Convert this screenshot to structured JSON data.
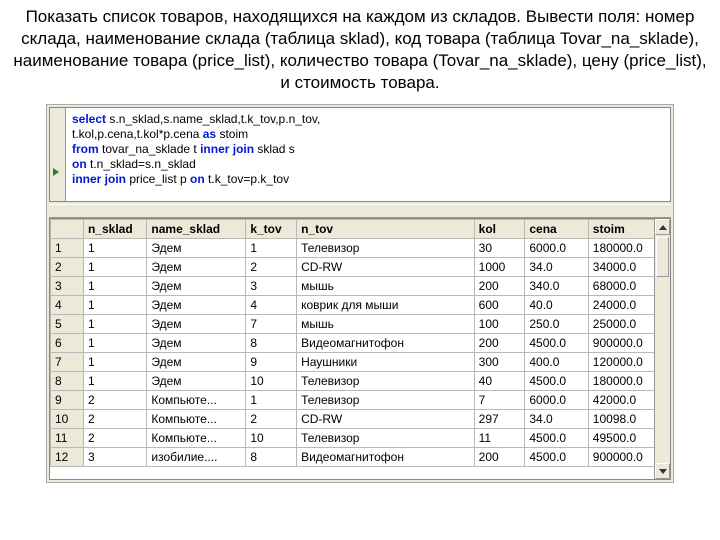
{
  "task": "Показать список товаров, находящихся на каждом из складов. Вывести поля: номер склада, наименование склада (таблица sklad), код товара (таблица Tovar_na_sklade), наименование товара (price_list), количество товара (Tovar_na_sklade), цену (price_list), и стоимость товара.",
  "sql": {
    "l1a": "select",
    "l1b": " s.n_sklad,s.name_sklad,t.k_tov,p.n_tov,",
    "l2a": "t.kol,p.cena,t.kol*p.cena ",
    "l2b": "as",
    "l2c": " stoim",
    "l3a": "from",
    "l3b": " tovar_na_sklade t ",
    "l3c": "inner join",
    "l3d": " sklad s",
    "l4a": "on",
    "l4b": " t.n_sklad=s.n_sklad",
    "l5a": "inner join",
    "l5b": " price_list p ",
    "l5c": "on",
    "l5d": " t.k_tov=p.k_tov"
  },
  "columns": {
    "n_sklad": "n_sklad",
    "name_sklad": "name_sklad",
    "k_tov": "k_tov",
    "n_tov": "n_tov",
    "kol": "kol",
    "cena": "cena",
    "stoim": "stoim"
  },
  "rows": [
    {
      "rn": "1",
      "n_sklad": "1",
      "name_sklad": "Эдем",
      "k_tov": "1",
      "n_tov": "Телевизор",
      "kol": "30",
      "cena": "6000.0",
      "stoim": "180000.0"
    },
    {
      "rn": "2",
      "n_sklad": "1",
      "name_sklad": "Эдем",
      "k_tov": "2",
      "n_tov": "CD-RW",
      "kol": "1000",
      "cena": "34.0",
      "stoim": "34000.0"
    },
    {
      "rn": "3",
      "n_sklad": "1",
      "name_sklad": "Эдем",
      "k_tov": "3",
      "n_tov": "мышь",
      "kol": "200",
      "cena": "340.0",
      "stoim": "68000.0"
    },
    {
      "rn": "4",
      "n_sklad": "1",
      "name_sklad": "Эдем",
      "k_tov": "4",
      "n_tov": "коврик для мыши",
      "kol": "600",
      "cena": "40.0",
      "stoim": "24000.0"
    },
    {
      "rn": "5",
      "n_sklad": "1",
      "name_sklad": "Эдем",
      "k_tov": "7",
      "n_tov": "мышь",
      "kol": "100",
      "cena": "250.0",
      "stoim": "25000.0"
    },
    {
      "rn": "6",
      "n_sklad": "1",
      "name_sklad": "Эдем",
      "k_tov": "8",
      "n_tov": "Видеомагнитофон",
      "kol": "200",
      "cena": "4500.0",
      "stoim": "900000.0"
    },
    {
      "rn": "7",
      "n_sklad": "1",
      "name_sklad": "Эдем",
      "k_tov": "9",
      "n_tov": "Наушники",
      "kol": "300",
      "cena": "400.0",
      "stoim": "120000.0"
    },
    {
      "rn": "8",
      "n_sklad": "1",
      "name_sklad": "Эдем",
      "k_tov": "10",
      "n_tov": "Телевизор",
      "kol": "40",
      "cena": "4500.0",
      "stoim": "180000.0"
    },
    {
      "rn": "9",
      "n_sklad": "2",
      "name_sklad": "Компьюте...",
      "k_tov": "1",
      "n_tov": "Телевизор",
      "kol": "7",
      "cena": "6000.0",
      "stoim": "42000.0"
    },
    {
      "rn": "10",
      "n_sklad": "2",
      "name_sklad": "Компьюте...",
      "k_tov": "2",
      "n_tov": "CD-RW",
      "kol": "297",
      "cena": "34.0",
      "stoim": "10098.0"
    },
    {
      "rn": "11",
      "n_sklad": "2",
      "name_sklad": "Компьюте...",
      "k_tov": "10",
      "n_tov": "Телевизор",
      "kol": "11",
      "cena": "4500.0",
      "stoim": "49500.0"
    },
    {
      "rn": "12",
      "n_sklad": "3",
      "name_sklad": "изобилие....",
      "k_tov": "8",
      "n_tov": "Видеомагнитофон",
      "kol": "200",
      "cena": "4500.0",
      "stoim": "900000.0"
    }
  ]
}
